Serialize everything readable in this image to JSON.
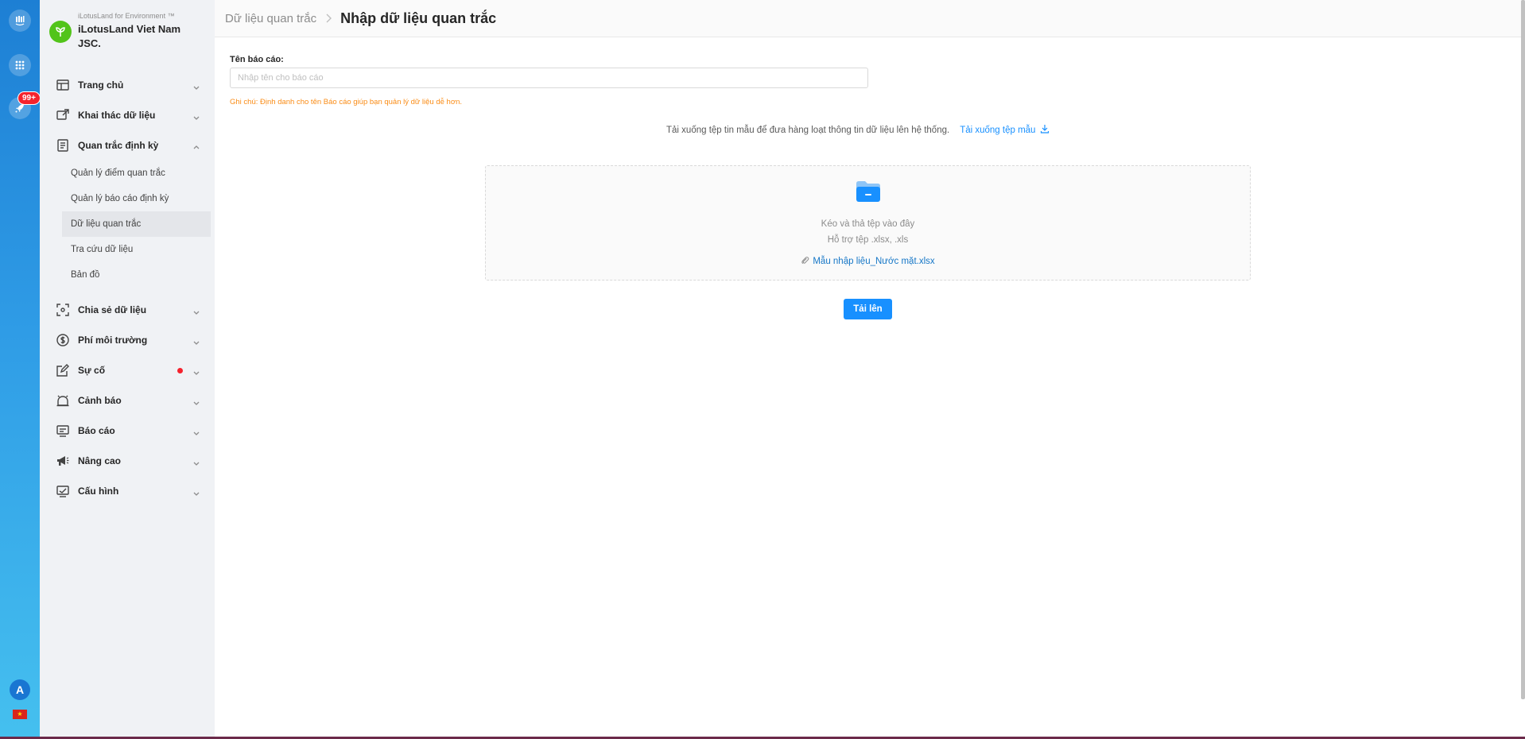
{
  "rail": {
    "badge": "99+",
    "avatar_initial": "A",
    "icons": [
      "app-logo-icon",
      "apps-grid-icon",
      "rocket-icon"
    ]
  },
  "sidebar": {
    "org_subtitle": "iLotusLand for Environment ™",
    "org_name": "iLotusLand Viet Nam JSC.",
    "items": [
      {
        "label": "Trang chủ",
        "icon": "home-layout-icon"
      },
      {
        "label": "Khai thác dữ liệu",
        "icon": "data-export-icon"
      },
      {
        "label": "Quan trắc định kỳ",
        "icon": "document-list-icon",
        "children": [
          {
            "label": "Quản lý điểm quan trắc"
          },
          {
            "label": "Quản lý báo cáo định kỳ"
          },
          {
            "label": "Dữ liệu quan trắc",
            "active": true
          },
          {
            "label": "Tra cứu dữ liệu"
          },
          {
            "label": "Bản đồ"
          }
        ]
      },
      {
        "label": "Chia sẻ dữ liệu",
        "icon": "share-focus-icon"
      },
      {
        "label": "Phí môi trường",
        "icon": "dollar-circle-icon"
      },
      {
        "label": "Sự cố",
        "icon": "edit-report-icon",
        "has_dot": true
      },
      {
        "label": "Cảnh báo",
        "icon": "alarm-bell-icon"
      },
      {
        "label": "Báo cáo",
        "icon": "monitor-report-icon"
      },
      {
        "label": "Nâng cao",
        "icon": "megaphone-icon"
      },
      {
        "label": "Cấu hình",
        "icon": "config-monitor-icon"
      }
    ]
  },
  "header": {
    "breadcrumb_parent": "Dữ liệu quan trắc",
    "page_title": "Nhập dữ liệu quan trắc"
  },
  "form": {
    "report_name_label": "Tên báo cáo:",
    "report_name_placeholder": "Nhập tên cho báo cáo",
    "report_name_value": "",
    "note": "Ghi chú: Định danh cho tên Báo cáo giúp bạn quản lý dữ liệu dễ hơn.",
    "download_hint": "Tải xuống tệp tin mẫu để đưa hàng loạt thông tin dữ liệu lên hệ thống.",
    "download_link": "Tải xuống tệp mẫu",
    "dropzone_text": "Kéo và thả tệp vào đây",
    "dropzone_support": "Hỗ trợ tệp .xlsx, .xls",
    "attached_file": "Mẫu nhập liệu_Nước mặt.xlsx",
    "upload_button": "Tải lên"
  },
  "colors": {
    "primary": "#1890ff",
    "note": "#fa8c16",
    "sidebar_bg": "#f0f2f5",
    "badge": "#f5222d"
  }
}
